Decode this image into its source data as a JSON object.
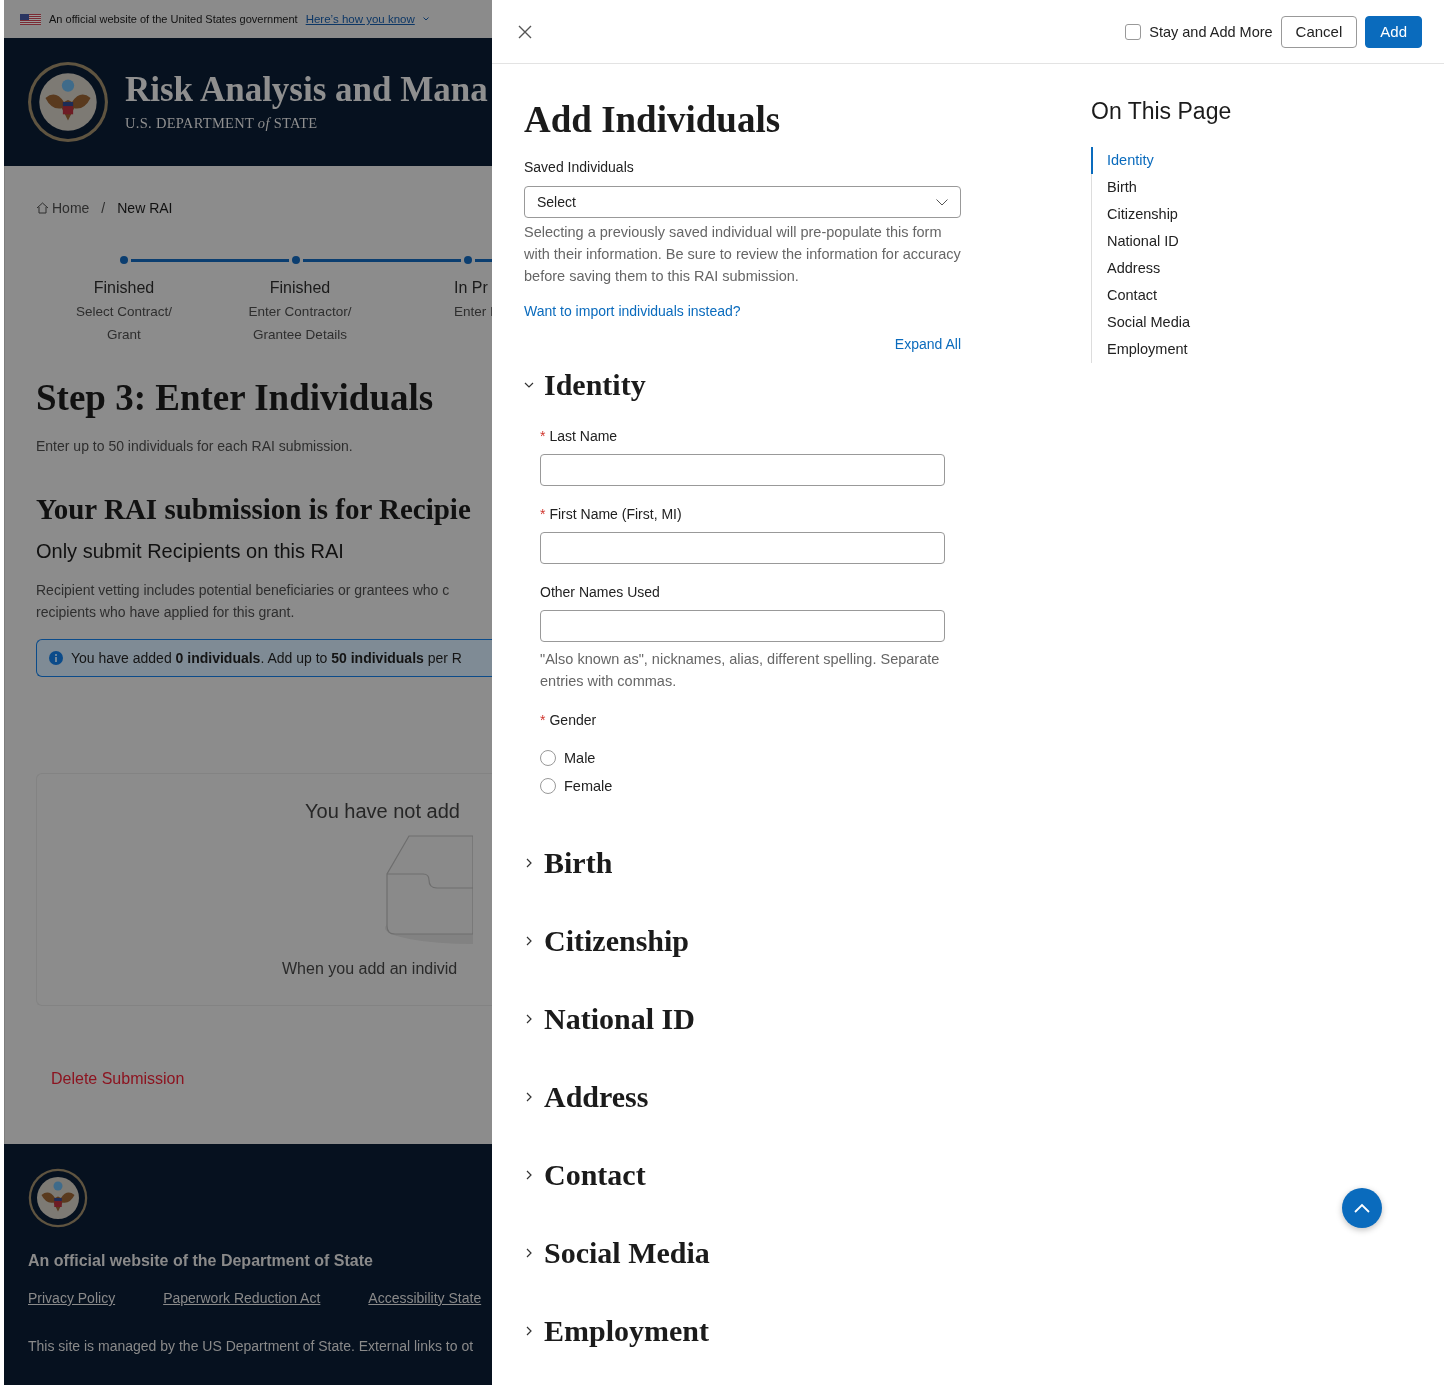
{
  "gov_banner": {
    "text": "An official website of the United States government",
    "link": "Here’s how you know"
  },
  "site_header": {
    "title": "Risk Analysis and Mana",
    "subtitle_before": "U.S. DEPARTMENT",
    "subtitle_of": "of",
    "subtitle_after": "STATE"
  },
  "breadcrumb": [
    {
      "label": "Home",
      "kind": "home"
    },
    {
      "label": "/",
      "kind": "separator"
    },
    {
      "label": "New RAI",
      "kind": "current"
    }
  ],
  "steps": [
    {
      "status": "Finished",
      "lines": [
        "Select Contract/",
        "Grant"
      ]
    },
    {
      "status": "Finished",
      "lines": [
        "Enter Contractor/",
        "Grantee Details"
      ]
    },
    {
      "status": "In Pr",
      "lines": [
        "Enter I"
      ]
    }
  ],
  "step_title": "Step 3: Enter Individuals",
  "step_intro": "Enter up to 50 individuals for each RAI submission.",
  "submission_heading": "Your RAI submission is for Recipie",
  "submission_subheading": "Only submit Recipients on this RAI",
  "submission_text": [
    "Recipient vetting includes potential beneficiaries or grantees who c",
    "recipients who have applied for this grant."
  ],
  "alert": "You have added **0 individuals**. Add up to **50 individuals** per R",
  "empty_state": {
    "title": "You have not add",
    "text": "When you add an individ"
  },
  "delete_link": "Delete Submission",
  "footer": {
    "title": "An official website of the Department of State",
    "links": [
      "Privacy Policy",
      "Paperwork Reduction Act",
      "Accessibility State"
    ],
    "note": "This site is managed by the US Department of State. External links to ot"
  },
  "drawer": {
    "stay_and_add_more": {
      "label": "Stay and Add More",
      "checked": false
    },
    "buttons": [
      {
        "label": "Cancel",
        "kind": "secondary"
      },
      {
        "label": "Add",
        "kind": "primary"
      }
    ],
    "title": "Add Individuals",
    "saved_individuals": {
      "label": "Saved Individuals",
      "value": "Select",
      "help": "Selecting a previously saved individual will pre-populate this form with their information. Be sure to review the information for accuracy before saving them to this RAI submission."
    },
    "import_link": "Want to import individuals instead?",
    "expand_all": "Expand All",
    "sections": [
      {
        "title": "Identity",
        "expanded": true,
        "fields": [
          {
            "kind": "text",
            "label": "Last Name",
            "required_marker": "*"
          },
          {
            "kind": "text",
            "label": "First Name (First, MI)",
            "required_marker": "*"
          },
          {
            "kind": "text",
            "label": "Other Names Used",
            "hint": "\"Also known as\", nicknames, alias, different spelling. Separate entries with commas."
          },
          {
            "kind": "radio",
            "label": "Gender",
            "required_marker": "*",
            "options": [
              {
                "label": "Male",
                "selected": false
              },
              {
                "label": "Female",
                "selected": false
              }
            ]
          }
        ]
      },
      {
        "title": "Birth",
        "expanded": false
      },
      {
        "title": "Citizenship",
        "expanded": false
      },
      {
        "title": "National ID",
        "expanded": false
      },
      {
        "title": "Address",
        "expanded": false
      },
      {
        "title": "Contact",
        "expanded": false
      },
      {
        "title": "Social Media",
        "expanded": false
      },
      {
        "title": "Employment",
        "expanded": false
      }
    ],
    "on_this_page": {
      "title": "On This Page",
      "items": [
        {
          "label": "Identity",
          "selected": true
        },
        {
          "label": "Birth",
          "selected": false
        },
        {
          "label": "Citizenship",
          "selected": false
        },
        {
          "label": "National ID",
          "selected": false
        },
        {
          "label": "Address",
          "selected": false
        },
        {
          "label": "Contact",
          "selected": false
        },
        {
          "label": "Social Media",
          "selected": false
        },
        {
          "label": "Employment",
          "selected": false
        }
      ]
    }
  }
}
